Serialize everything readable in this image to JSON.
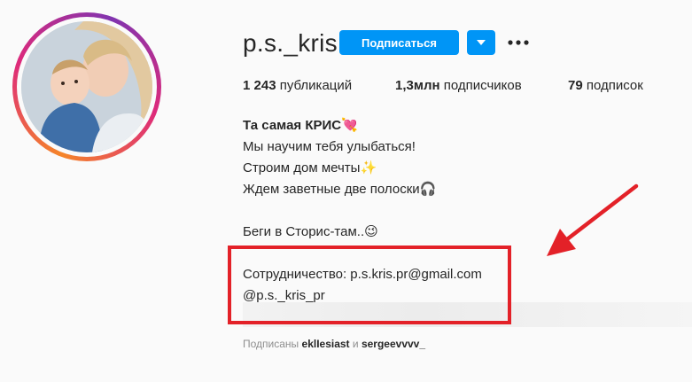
{
  "profile": {
    "username": "p.s._kris",
    "follow_label": "Подписаться"
  },
  "stats": [
    {
      "count": "1 243",
      "label": "публикаций"
    },
    {
      "count": "1,3млн",
      "label": "подписчиков"
    },
    {
      "count": "79",
      "label": "подписок"
    }
  ],
  "bio": {
    "name": "Та самая КРИС💘",
    "lines": [
      "Мы научим тебя улыбаться!",
      "Строим дом мечты✨",
      "Ждем заветные две полоски🎧",
      "Беги в Сторис-там..😉",
      "Сотрудничество: p.s.kris.pr@gmail.com",
      "@p.s._kris_pr"
    ]
  },
  "followed_by": {
    "prefix": "Подписаны",
    "account1": "eklIesiast",
    "joiner": "и",
    "account2": "sergeevvvv_"
  },
  "colors": {
    "accent": "#0095f6",
    "annotation": "#e32128"
  },
  "icons": {
    "dropdown": "chevron-down-icon",
    "more": "more-horizontal-icon"
  }
}
